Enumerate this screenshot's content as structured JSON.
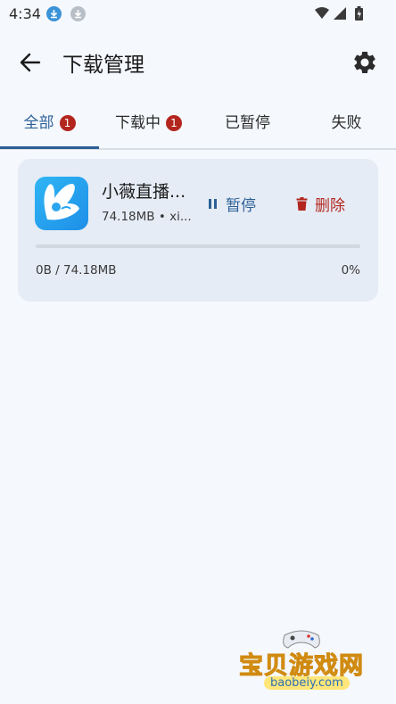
{
  "status_bar": {
    "time": "4:34"
  },
  "app_bar": {
    "title": "下载管理"
  },
  "tabs": [
    {
      "label": "全部",
      "badge": "1",
      "active": true
    },
    {
      "label": "下载中",
      "badge": "1",
      "active": false
    },
    {
      "label": "已暂停",
      "badge": "",
      "active": false
    },
    {
      "label": "失败",
      "badge": "",
      "active": false
    }
  ],
  "download": {
    "name": "小薇直播...",
    "meta": "74.18MB • xi...",
    "pause_label": "暂停",
    "delete_label": "删除",
    "size_progress": "0B / 74.18MB",
    "percent_text": "0%",
    "progress": 0
  },
  "watermark": {
    "text": "宝贝游戏网",
    "domain": "baobeiy.com"
  },
  "colors": {
    "accent": "#2b5f96",
    "danger": "#b3261e",
    "background": "#f5f8fd",
    "card": "#e6ecf5"
  }
}
